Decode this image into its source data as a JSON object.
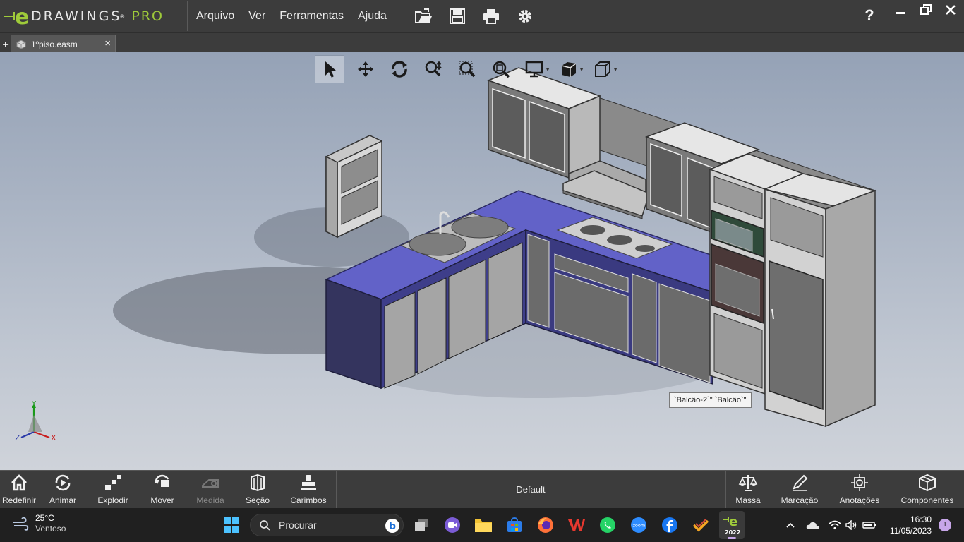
{
  "app": {
    "logo_text": "DRAWINGS",
    "logo_reg": "®",
    "logo_pro": "PRO",
    "brand_color": "#9fcb3a"
  },
  "menu": [
    "Arquivo",
    "Ver",
    "Ferramentas",
    "Ajuda"
  ],
  "quick_icons": [
    "open-icon",
    "save-icon",
    "print-icon",
    "settings-icon"
  ],
  "help_label": "?",
  "tabs": {
    "add_label": "+",
    "document": {
      "label": "1ºpiso.easm",
      "close": "×"
    }
  },
  "view_tools": [
    "select-icon",
    "pan-icon",
    "rotate-icon",
    "zoom-icon",
    "zoom-area-icon",
    "zoom-fit-icon",
    "display-style-icon",
    "view-orientation-icon",
    "3d-view-icon"
  ],
  "tooltip": "`Balcão-2`\" `Balcão`\"",
  "triad": {
    "x": "X",
    "y": "Y",
    "z": "Z"
  },
  "bottom_tools": [
    {
      "label": "Redefinir",
      "icon": "home-icon",
      "enabled": true
    },
    {
      "label": "Animar",
      "icon": "animate-icon",
      "enabled": true
    },
    {
      "label": "Explodir",
      "icon": "explode-icon",
      "enabled": true
    },
    {
      "label": "Mover",
      "icon": "move-icon",
      "enabled": true
    },
    {
      "label": "Medida",
      "icon": "measure-icon",
      "enabled": false
    },
    {
      "label": "Seção",
      "icon": "section-icon",
      "enabled": true
    },
    {
      "label": "Carimbos",
      "icon": "stamp-icon",
      "enabled": true
    }
  ],
  "configuration": "Default",
  "right_tools": [
    {
      "label": "Massa",
      "icon": "mass-icon"
    },
    {
      "label": "Marcação",
      "icon": "markup-icon"
    },
    {
      "label": "Anotações",
      "icon": "annotations-icon"
    },
    {
      "label": "Componentes",
      "icon": "components-icon"
    }
  ],
  "taskbar": {
    "weather": {
      "temp": "25°C",
      "condition": "Ventoso"
    },
    "search_placeholder": "Procurar",
    "edrawings_badge": "2022",
    "apps": [
      "start-icon",
      "search-icon",
      "task-view-icon",
      "teams-icon",
      "file-explorer-icon",
      "store-icon",
      "firefox-icon",
      "wps-icon",
      "whatsapp-icon",
      "zoom-icon",
      "facebook-icon",
      "todo-icon",
      "edrawings-icon"
    ],
    "clock": {
      "time": "16:30",
      "date": "11/05/2023"
    },
    "notifications": "1"
  }
}
